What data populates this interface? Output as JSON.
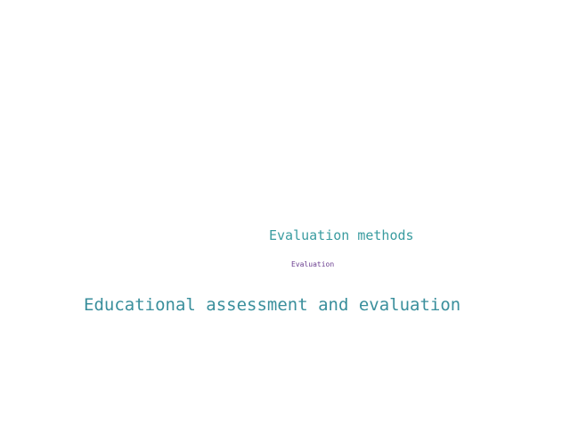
{
  "words": [
    {
      "text": "Evaluation methods",
      "color": "#3a9ca0"
    },
    {
      "text": "Evaluation",
      "color": "#6a3d8f"
    },
    {
      "text": "Educational assessment and evaluation",
      "color": "#3a8f9c"
    }
  ]
}
